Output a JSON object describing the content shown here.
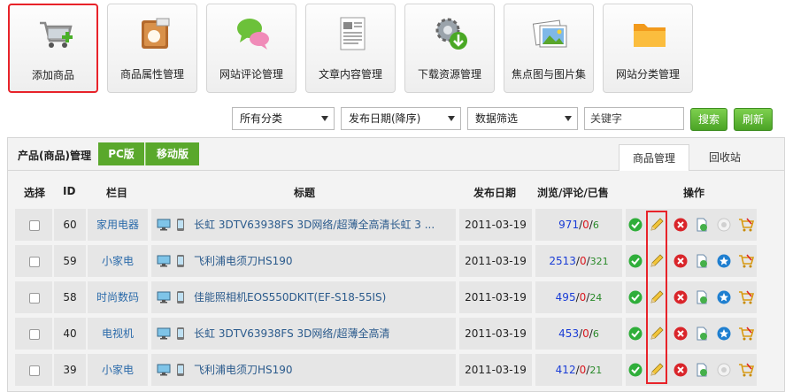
{
  "toolbar": [
    {
      "label": "添加商品",
      "icon": "cart-add-icon"
    },
    {
      "label": "商品属性管理",
      "icon": "product-attributes-icon"
    },
    {
      "label": "网站评论管理",
      "icon": "comments-icon"
    },
    {
      "label": "文章内容管理",
      "icon": "article-icon"
    },
    {
      "label": "下载资源管理",
      "icon": "download-gear-icon"
    },
    {
      "label": "焦点图与图片集",
      "icon": "picture-gallery-icon"
    },
    {
      "label": "网站分类管理",
      "icon": "folder-icon"
    }
  ],
  "filters": {
    "category": "所有分类",
    "sort": "发布日期(降序)",
    "data_filter": "数据筛选",
    "keyword_placeholder": "关键字",
    "search": "搜索",
    "refresh": "刷新"
  },
  "panel": {
    "title": "产品(商品)管理",
    "seg_pc": "PC版",
    "seg_mobile": "移动版",
    "tab_products": "商品管理",
    "tab_recycle": "回收站"
  },
  "columns": {
    "select": "选择",
    "id": "ID",
    "category": "栏目",
    "title": "标题",
    "date": "发布日期",
    "stats": "浏览/评论/已售",
    "actions": "操作"
  },
  "rows": [
    {
      "id": "60",
      "category": "家用电器",
      "title": "长虹 3DTV63938FS 3D网络/超薄全高清长虹 3 ...",
      "date": "2011-03-19",
      "views": "971",
      "comments": "0",
      "sold": "6",
      "starred": false
    },
    {
      "id": "59",
      "category": "小家电",
      "title": "飞利浦电须刀HS190",
      "date": "2011-03-19",
      "views": "2513",
      "comments": "0",
      "sold": "321",
      "starred": true
    },
    {
      "id": "58",
      "category": "时尚数码",
      "title": "佳能照相机EOS550DKIT(EF-S18-55IS)",
      "date": "2011-03-19",
      "views": "495",
      "comments": "0",
      "sold": "24",
      "starred": true
    },
    {
      "id": "40",
      "category": "电视机",
      "title": "长虹 3DTV63938FS 3D网络/超薄全高清",
      "date": "2011-03-19",
      "views": "453",
      "comments": "0",
      "sold": "6",
      "starred": true
    },
    {
      "id": "39",
      "category": "小家电",
      "title": "飞利浦电须刀HS190",
      "date": "2011-03-19",
      "views": "412",
      "comments": "0",
      "sold": "21",
      "starred": false
    }
  ],
  "colors": {
    "accent_green": "#5aa82c",
    "highlight_red": "#e8232a",
    "link_blue": "#2a5a8c"
  }
}
